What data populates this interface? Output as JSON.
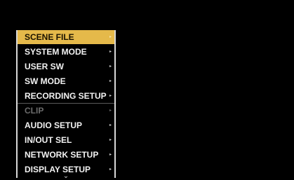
{
  "menu": {
    "items": [
      {
        "label": "SCENE FILE",
        "state": "selected",
        "arrow": "▸"
      },
      {
        "label": "SYSTEM MODE",
        "state": "normal",
        "arrow": "▸"
      },
      {
        "label": "USER SW",
        "state": "normal",
        "arrow": "▸"
      },
      {
        "label": "SW MODE",
        "state": "normal",
        "arrow": "▸"
      },
      {
        "label": "RECORDING SETUP",
        "state": "normal",
        "arrow": "▸"
      },
      {
        "label": "CLIP",
        "state": "disabled",
        "arrow": "▸"
      },
      {
        "label": "AUDIO SETUP",
        "state": "normal",
        "arrow": "▸"
      },
      {
        "label": "IN/OUT SEL",
        "state": "normal",
        "arrow": "▸"
      },
      {
        "label": "NETWORK SETUP",
        "state": "normal",
        "arrow": "▸"
      },
      {
        "label": "DISPLAY SETUP",
        "state": "normal",
        "arrow": "▸"
      }
    ],
    "scroll_indicator": "⌄"
  },
  "colors": {
    "background": "#000000",
    "selected_bg": "#e5b94a",
    "text": "#f2f2f2",
    "disabled_text": "#6c6c6c"
  }
}
